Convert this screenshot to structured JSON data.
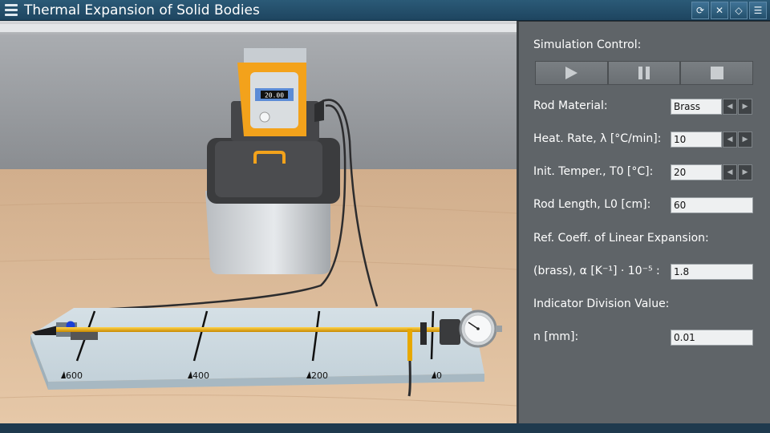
{
  "app": {
    "title": "Thermal Expansion of Solid Bodies"
  },
  "toolbar": {
    "icons": [
      "reset-icon",
      "mute-icon",
      "eraser-icon",
      "list-icon"
    ]
  },
  "scene": {
    "thermostat_display": "20.00",
    "scale_labels": [
      "600",
      "400",
      "200",
      "0"
    ]
  },
  "panel": {
    "sim_control_label": "Simulation Control:",
    "rod_material_label": "Rod Material:",
    "rod_material_value": "Brass",
    "heat_rate_label": "Heat. Rate, λ [°C/min]:",
    "heat_rate_value": "10",
    "init_temp_label": "Init. Temper., T0 [°C]:",
    "init_temp_value": "20",
    "rod_length_label": "Rod Length, L0 [cm]:",
    "rod_length_value": "60",
    "ref_coeff_label": "Ref. Coeff. of Linear Expansion:",
    "alpha_label": "(brass), α [K⁻¹] · 10⁻⁵ :",
    "alpha_value": "1.8",
    "indicator_label": "Indicator Division Value:",
    "n_label": "n [mm]:",
    "n_value": "0.01"
  },
  "colors": {
    "titlebar": "#24506c",
    "panel": "#5f6468",
    "rod": "#e7a800",
    "thermostat_orange": "#f3a21b"
  }
}
